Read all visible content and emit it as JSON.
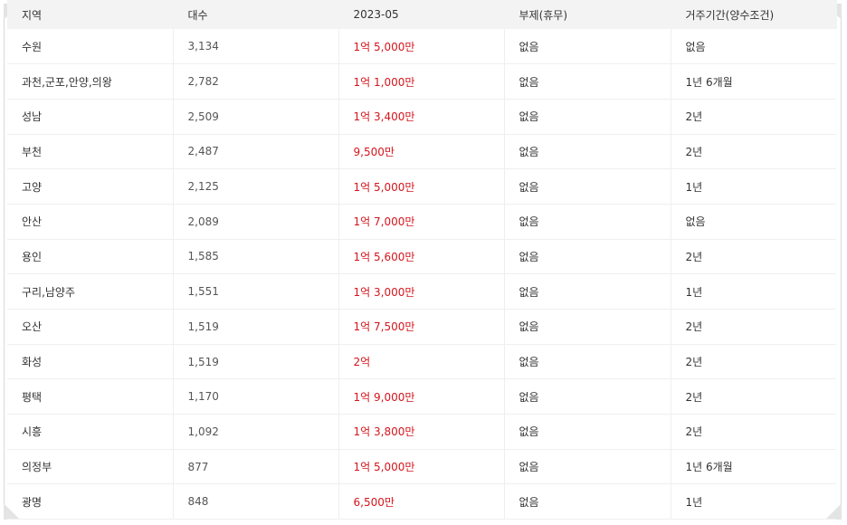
{
  "table": {
    "headers": [
      "지역",
      "대수",
      "2023-05",
      "부제(휴무)",
      "거주기간(양수조건)"
    ],
    "rows": [
      {
        "region": "수원",
        "count": "3,134",
        "price": "1억 5,000만",
        "rest": "없음",
        "period": "없음"
      },
      {
        "region": "과천,군포,안양,의왕",
        "count": "2,782",
        "price": "1억 1,000만",
        "rest": "없음",
        "period": "1년 6개월"
      },
      {
        "region": "성남",
        "count": "2,509",
        "price": "1억 3,400만",
        "rest": "없음",
        "period": "2년"
      },
      {
        "region": "부천",
        "count": "2,487",
        "price": "9,500만",
        "rest": "없음",
        "period": "2년"
      },
      {
        "region": "고양",
        "count": "2,125",
        "price": "1억 5,000만",
        "rest": "없음",
        "period": "1년"
      },
      {
        "region": "안산",
        "count": "2,089",
        "price": "1억 7,000만",
        "rest": "없음",
        "period": "없음"
      },
      {
        "region": "용인",
        "count": "1,585",
        "price": "1억 5,600만",
        "rest": "없음",
        "period": "2년"
      },
      {
        "region": "구리,남양주",
        "count": "1,551",
        "price": "1억 3,000만",
        "rest": "없음",
        "period": "1년"
      },
      {
        "region": "오산",
        "count": "1,519",
        "price": "1억 7,500만",
        "rest": "없음",
        "period": "2년"
      },
      {
        "region": "화성",
        "count": "1,519",
        "price": "2억",
        "rest": "없음",
        "period": "2년"
      },
      {
        "region": "평택",
        "count": "1,170",
        "price": "1억 9,000만",
        "rest": "없음",
        "period": "2년"
      },
      {
        "region": "시흥",
        "count": "1,092",
        "price": "1억 3,800만",
        "rest": "없음",
        "period": "2년"
      },
      {
        "region": "의정부",
        "count": "877",
        "price": "1억 5,000만",
        "rest": "없음",
        "period": "1년 6개월"
      },
      {
        "region": "광명",
        "count": "848",
        "price": "6,500만",
        "rest": "없음",
        "period": "1년"
      }
    ]
  },
  "colors": {
    "price": "#d4151c",
    "header_bg": "#f3f3f3",
    "text": "#333333"
  }
}
